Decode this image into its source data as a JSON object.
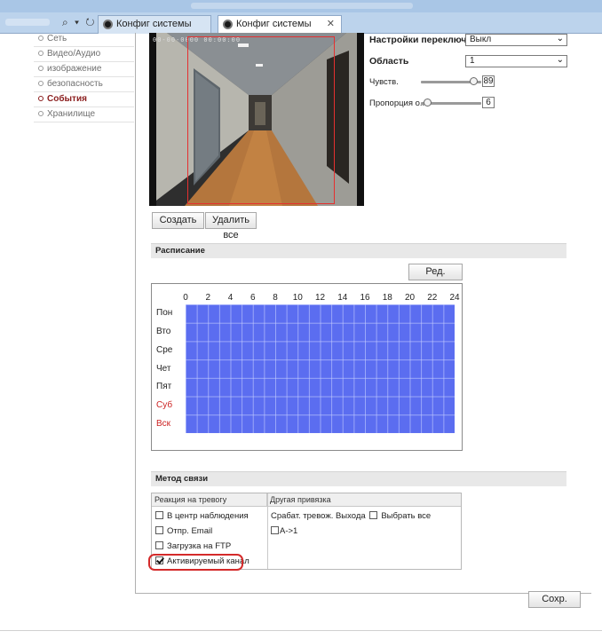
{
  "browser": {
    "tabs": [
      {
        "label": "Конфиг системы",
        "active": false
      },
      {
        "label": "Конфиг системы",
        "active": true
      }
    ],
    "close_glyph": "✕",
    "nav_icons": "⌕ ▾ ↻"
  },
  "sidebar": {
    "items": [
      {
        "label": "Сеть",
        "active": false
      },
      {
        "label": "Видео/Аудио",
        "active": false
      },
      {
        "label": "изображение",
        "active": false
      },
      {
        "label": "безопасность",
        "active": false
      },
      {
        "label": "События",
        "active": true
      },
      {
        "label": "Хранилище",
        "active": false
      }
    ]
  },
  "video": {
    "timestamp": "00-00-0000 00:00:00"
  },
  "settings": {
    "switch_label": "Настройки переключ...",
    "switch_value": "Выкл",
    "area_label": "Область",
    "area_value": "1",
    "sensitivity_label": "Чувств.",
    "sensitivity_value": "89",
    "proportion_label": "Пропорция о...",
    "proportion_value": "6"
  },
  "buttons": {
    "create": "Создать",
    "delete_all": "Удалить все",
    "edit": "Ред.",
    "save": "Сохр."
  },
  "schedule": {
    "title": "Расписание",
    "hours": [
      "0",
      "2",
      "4",
      "6",
      "8",
      "10",
      "12",
      "14",
      "16",
      "18",
      "20",
      "22",
      "24"
    ],
    "days": [
      {
        "label": "Пон",
        "weekend": false
      },
      {
        "label": "Вто",
        "weekend": false
      },
      {
        "label": "Сре",
        "weekend": false
      },
      {
        "label": "Чет",
        "weekend": false
      },
      {
        "label": "Пят",
        "weekend": false
      },
      {
        "label": "Суб",
        "weekend": true
      },
      {
        "label": "Вск",
        "weekend": true
      }
    ],
    "fill_color": "#5b6df0"
  },
  "method": {
    "title": "Метод связи",
    "col1_header": "Реакция на тревогу",
    "col2_header": "Другая привязка",
    "alarm_reactions": [
      {
        "label": "В центр наблюдения",
        "checked": false
      },
      {
        "label": "Отпр. Email",
        "checked": false
      },
      {
        "label": "Загрузка на FTP",
        "checked": false
      },
      {
        "label": "Активируемый канал",
        "checked": true
      }
    ],
    "trigger_output_label": "Срабат. тревож. Выхода",
    "select_all_label": "Выбрать все",
    "output_a1": "A->1"
  },
  "colors": {
    "accent_red": "#d42a2a",
    "sidebar_active": "#8b1e1e",
    "browser_blue": "#bcd3ec"
  }
}
